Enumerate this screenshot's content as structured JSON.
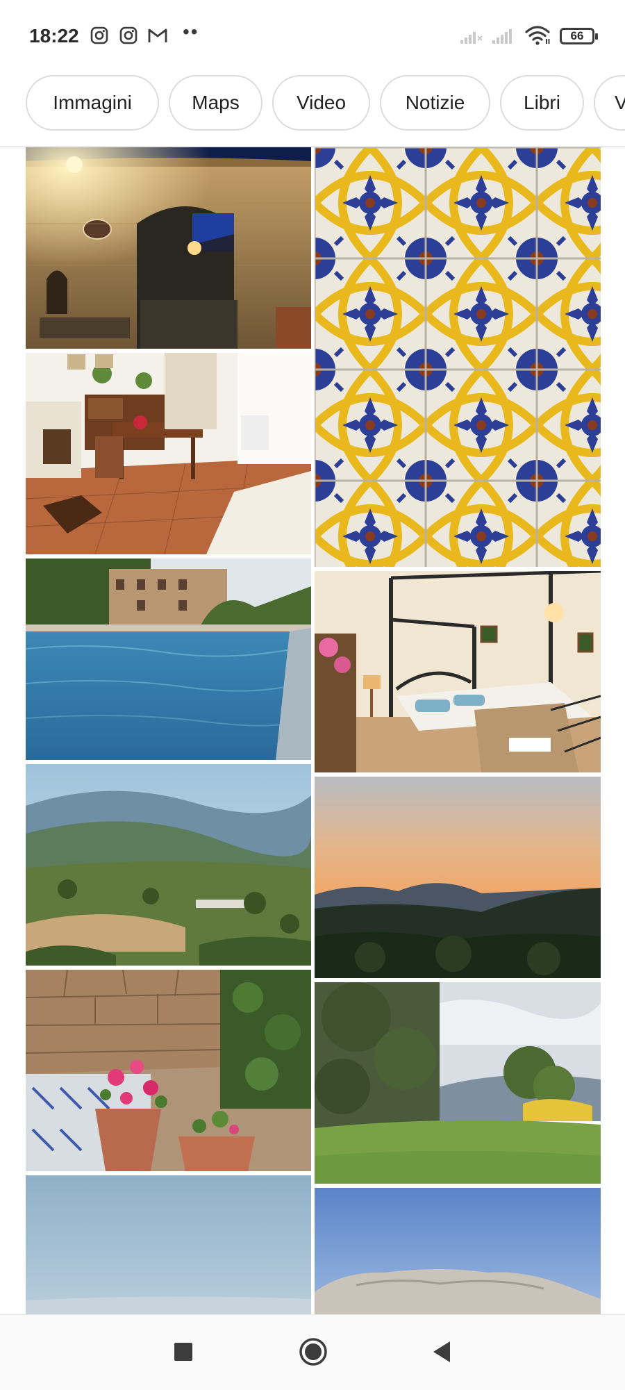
{
  "status_bar": {
    "time": "18:22",
    "notification_icons": [
      "instagram-icon",
      "instagram-icon",
      "gmail-icon"
    ],
    "more_dots": "••",
    "battery": "66"
  },
  "filter_chips": [
    "Immagini",
    "Maps",
    "Video",
    "Notizie",
    "Libri",
    "V"
  ],
  "images": [
    {
      "name": "stone-courtyard-night"
    },
    {
      "name": "majolica-tiles"
    },
    {
      "name": "rustic-living-room"
    },
    {
      "name": "swimming-pool"
    },
    {
      "name": "four-poster-bedroom"
    },
    {
      "name": "mountain-valley"
    },
    {
      "name": "sunset-hills"
    },
    {
      "name": "flower-pots"
    },
    {
      "name": "green-meadow"
    },
    {
      "name": "sky-horizon"
    },
    {
      "name": "rocky-mountain"
    }
  ],
  "navigation": [
    "recent-apps-button",
    "home-button",
    "back-button"
  ]
}
